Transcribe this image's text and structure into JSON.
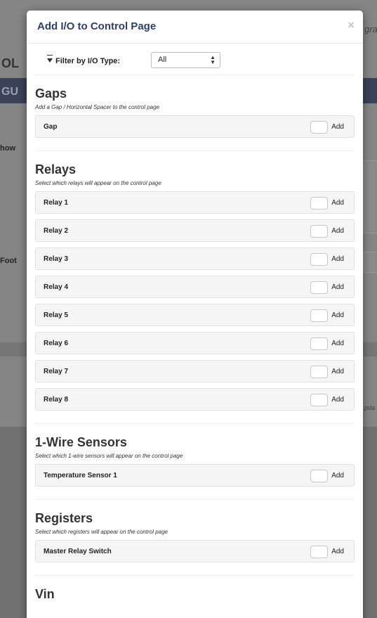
{
  "background": {
    "brand_fragment": "OL",
    "nav_fragment": "GU",
    "show_label": "how",
    "footer_label": "Foot",
    "right_fragment_top": "gra",
    "right_fragment_bottom": "pda"
  },
  "modal": {
    "title": "Add I/O to Control Page",
    "close_glyph": "×",
    "filter": {
      "label": "Filter by I/O Type:",
      "selected": "All"
    },
    "add_label": "Add",
    "sections": [
      {
        "heading": "Gaps",
        "description": "Add a Gap / Horizontal Spacer to the control page",
        "items": [
          "Gap"
        ]
      },
      {
        "heading": "Relays",
        "description": "Select which relays will appear on the control page",
        "items": [
          "Relay 1",
          "Relay 2",
          "Relay 3",
          "Relay 4",
          "Relay 5",
          "Relay 6",
          "Relay 7",
          "Relay 8"
        ]
      },
      {
        "heading": "1-Wire Sensors",
        "description": "Select which 1-wire sensors will appear on the control page",
        "items": [
          "Temperature Sensor 1"
        ]
      },
      {
        "heading": "Registers",
        "description": "Select which registers will appear on the control page",
        "items": [
          "Master Relay Switch"
        ]
      },
      {
        "heading": "Vin",
        "description": "",
        "items": []
      }
    ]
  }
}
